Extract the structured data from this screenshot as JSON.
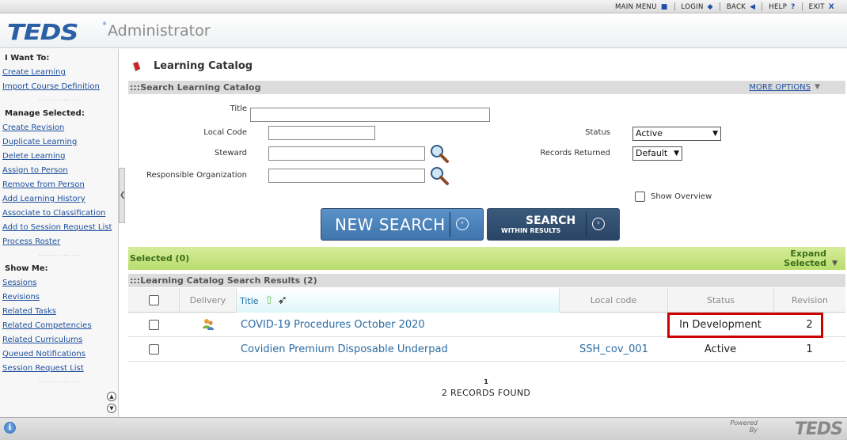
{
  "topnav": {
    "items": [
      {
        "label": "MAIN MENU",
        "icon": "■"
      },
      {
        "label": "LOGIN",
        "icon": "◆"
      },
      {
        "label": "BACK",
        "icon": "◀"
      },
      {
        "label": "HELP",
        "icon": "?"
      },
      {
        "label": "EXIT",
        "icon": "X"
      }
    ]
  },
  "header": {
    "logo": "TEDS",
    "reg": "®",
    "title": "Administrator"
  },
  "sidebar": {
    "i_want_to": {
      "heading": "I Want To:",
      "items": [
        "Create Learning",
        "Import Course Definition"
      ]
    },
    "manage_selected": {
      "heading": "Manage Selected:",
      "items": [
        "Create Revision",
        "Duplicate Learning",
        "Delete Learning",
        "Assign to Person",
        "Remove from Person",
        "Add Learning History",
        "Associate to Classification",
        "Add to Session Request List",
        "Process Roster"
      ]
    },
    "show_me": {
      "heading": "Show Me:",
      "items": [
        "Sessions",
        "Revisions",
        "Related Tasks",
        "Related Competencies",
        "Related Curriculums",
        "Queued Notifications",
        "Session Request List"
      ]
    },
    "dots": "..............."
  },
  "main": {
    "page_title": "Learning Catalog",
    "search_bar": {
      "title": ":::Search Learning Catalog",
      "more_options": "MORE OPTIONS"
    },
    "form": {
      "title_label": "Title",
      "local_code_label": "Local Code",
      "steward_label": "Steward",
      "responsible_org_label": "Responsible Organization",
      "status_label": "Status",
      "status_value": "Active",
      "records_returned_label": "Records Returned",
      "records_returned_value": "Default",
      "show_overview_label": "Show Overview"
    },
    "buttons": {
      "new_search": "NEW SEARCH",
      "search_within_l1": "SEARCH",
      "search_within_l2": "WITHIN RESULTS"
    },
    "selected_bar": {
      "label": "Selected (0)",
      "expand_l1": "Expand",
      "expand_l2": "Selected"
    },
    "results": {
      "title": ":::Learning Catalog Search Results (2)",
      "columns": {
        "delivery": "Delivery",
        "title": "Title",
        "local_code": "Local code",
        "status": "Status",
        "revision": "Revision"
      },
      "rows": [
        {
          "title": "COVID-19 Procedures October 2020",
          "local_code": "",
          "status": "In Development",
          "revision": "2"
        },
        {
          "title": "Covidien Premium Disposable Underpad",
          "local_code": "SSH_cov_001",
          "status": "Active",
          "revision": "1"
        }
      ]
    },
    "pager": "1",
    "records_found": "2 RECORDS FOUND"
  },
  "footer": {
    "powered": "Powered",
    "by": "By",
    "logo": "TEDS"
  }
}
